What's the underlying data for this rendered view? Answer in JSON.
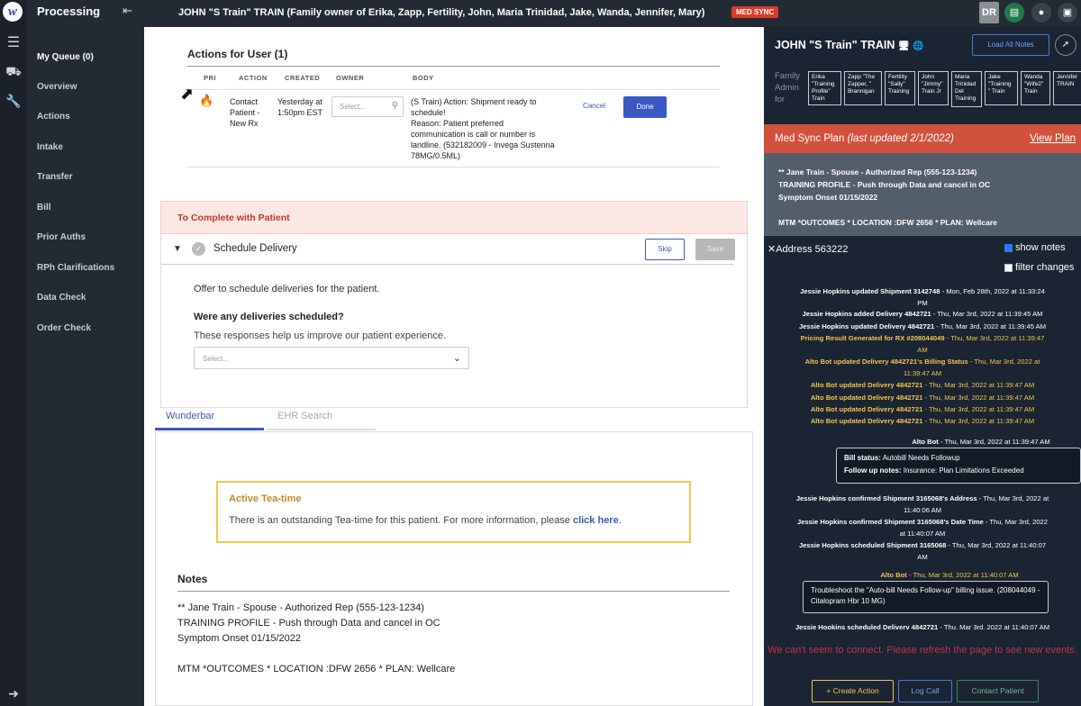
{
  "app": {
    "sidebar_title": "Processing",
    "nav": [
      "My Queue (0)",
      "Overview",
      "Actions",
      "Intake",
      "Transfer",
      "Bill",
      "Prior Auths",
      "RPh Clarifications",
      "Data Check",
      "Order Check"
    ]
  },
  "header": {
    "patient_title": "JOHN \"S Train\" TRAIN (Family owner of Erika, Zapp, Fertility, John, Maria Trinidad, Jake, Wanda, Jennifer, Mary)",
    "badge": "MED SYNC",
    "avatar": "DR"
  },
  "actions": {
    "title": "Actions for User (1)",
    "columns": [
      "PRI",
      "ACTION",
      "CREATED",
      "OWNER",
      "BODY"
    ],
    "row": {
      "action": "Contact Patient - New Rx",
      "created": "Yesterday at 1:50pm EST",
      "owner_placeholder": "Select...",
      "body": "(S Train) Action: Shipment ready to schedule!\nReason: Patient preferred communication is call or number is landline. (532182009 - Invega Sustenna 78MG/0.5ML)",
      "cancel": "Cancel",
      "done": "Done"
    }
  },
  "complete": {
    "title": "To Complete with Patient",
    "task": "Schedule Delivery",
    "skip": "Skip",
    "save": "Save",
    "desc": "Offer to schedule deliveries for the patient.",
    "question": "Were any deliveries scheduled?",
    "help": "These responses help us improve our patient experience.",
    "select_placeholder": "Select..."
  },
  "tabs": {
    "wunderbar": "Wunderbar",
    "ehr": "EHR Search"
  },
  "tea": {
    "title": "Active Tea-time",
    "text": "There is an outstanding Tea-time for this patient. For more information, please",
    "link": "click here",
    "period": "."
  },
  "notes": {
    "title": "Notes",
    "lines": [
      "** Jane Train - Spouse - Authorized Rep (555-123-1234)",
      "TRAINING PROFILE - Push through Data and cancel in OC",
      "Symptom Onset 01/15/2022",
      "",
      "MTM *OUTCOMES * LOCATION :DFW 2656 * PLAN: Wellcare"
    ]
  },
  "right": {
    "title": "JOHN \"S Train\" TRAIN",
    "load_notes": "Load All Notes",
    "family_label": "Family Admin for",
    "family": [
      "Erika \"Training Profile\" Train",
      "Zapp \"The Zapper, \" Brannigan",
      "Fertility \"Sally\" Training",
      "John \"Jimmy\" Train Jr",
      "Maria Trinidad Del Training",
      "Jake \"Training \" Train",
      "Wanda \"Wife2\" Train",
      "Jennifer TRAIN"
    ],
    "medsync_title": "Med Sync Plan",
    "medsync_updated": "(last updated 2/1/2022)",
    "view_plan": "View Plan",
    "plan_lines": [
      "** Jane Train - Spouse - Authorized Rep (555-123-1234)",
      "TRAINING PROFILE - Push through Data and cancel in OC",
      "Symptom Onset 01/15/2022",
      "",
      "MTM *OUTCOMES * LOCATION :DFW 2656 * PLAN: Wellcare"
    ],
    "address": "Address 563222",
    "show_notes": "show notes",
    "filter_changes": "filter changes",
    "events": [
      {
        "who": "Jessie Hopkins updated Shipment 3142748",
        "when": " - Mon, Feb 28th, 2022 at 11:33:24",
        "yellow": false
      },
      {
        "who": "",
        "when": "PM",
        "yellow": false
      },
      {
        "who": "Jessie Hopkins added Delivery 4842721",
        "when": " - Thu, Mar 3rd, 2022 at 11:39:45 AM",
        "yellow": false
      },
      {
        "who": "Jessie Hopkins updated Delivery 4842721",
        "when": " - Thu, Mar 3rd, 2022 at 11:39:45 AM",
        "yellow": false
      },
      {
        "who": "Pricing Result Generated for RX #208044049",
        "when": " - Thu, Mar 3rd, 2022 at 11:39:47",
        "yellow": true
      },
      {
        "who": "",
        "when": "AM",
        "yellow": true
      },
      {
        "who": "Alto Bot updated Delivery 4842721's Billing Status",
        "when": " - Thu, Mar 3rd, 2022 at",
        "yellow": true
      },
      {
        "who": "",
        "when": "11:39:47 AM",
        "yellow": true
      },
      {
        "who": "Alto Bot updated Delivery 4842721",
        "when": " - Thu, Mar 3rd, 2022 at 11:39:47 AM",
        "yellow": true
      },
      {
        "who": "Alto Bot updated Delivery 4842721",
        "when": " - Thu, Mar 3rd, 2022 at 11:39:47 AM",
        "yellow": true
      },
      {
        "who": "Alto Bot updated Delivery 4842721",
        "when": " - Thu, Mar 3rd, 2022 at 11:39:47 AM",
        "yellow": true
      },
      {
        "who": "Alto Bot updated Delivery 4842721",
        "when": " - Thu, Mar 3rd, 2022 at 11:39:47 AM",
        "yellow": true
      }
    ],
    "bot1": {
      "who": "Alto Bot",
      "when": " - Thu, Mar 3rd, 2022 at 11:39:47 AM"
    },
    "bill_status_label": "Bill status:",
    "bill_status": "Autobill Needs Followup",
    "followup_label": "Follow up notes:",
    "followup": "Insurance: Plan Limitations Exceeded",
    "events2": [
      {
        "who": "Jessie Hopkins confirmed Shipment 3165068's Address",
        "when": " - Thu, Mar 3rd, 2022 at"
      },
      {
        "who": "",
        "when": "11:40:06 AM"
      },
      {
        "who": "Jessie Hopkins confirmed Shipment 3165068's Date Time",
        "when": " - Thu, Mar 3rd, 2022"
      },
      {
        "who": "",
        "when": "at 11:40:07 AM"
      },
      {
        "who": "Jessie Hopkins scheduled Shipment 3165068",
        "when": " - Thu, Mar 3rd, 2022 at 11:40:07"
      },
      {
        "who": "",
        "when": "AM"
      }
    ],
    "bot2": {
      "who": "Alto Bot",
      "when": " - Thu, Mar 3rd, 2022 at 11:40:07 AM"
    },
    "bot2_note": "Troubleshoot the \"Auto-bill Needs Follow-up\" billing issue. (208044049 - Citalopram Hbr 10 MG)",
    "last_event": {
      "who": "Jessie Hookins scheduled Deliverv 4842721",
      "when": " - Thu. Mar 3rd. 2022 at 11:40:07 AM"
    },
    "error": "We can't seem to connect. Please refresh the page to see new events.",
    "create_action": "+ Create Action",
    "log_call": "Log Call",
    "contact_patient": "Contact Patient"
  },
  "colors": {
    "accent": "#3b57c4",
    "danger": "#d83c2a",
    "dark": "#1a2433",
    "yellow": "#f2c44b"
  },
  "icons": [
    "menu-icon",
    "truck-icon",
    "wrench-icon",
    "logout-icon",
    "collapse-icon",
    "fire-icon",
    "check-circle-icon",
    "caret-down-icon",
    "search-icon",
    "chevron-down-icon",
    "pin-icon",
    "chat-icon",
    "lock-icon"
  ]
}
